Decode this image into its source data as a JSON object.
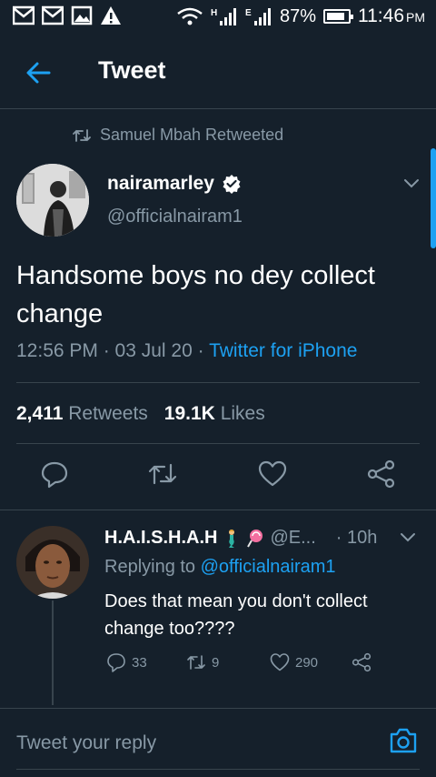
{
  "status_bar": {
    "battery": "87%",
    "battery_level": 0.87,
    "time": "11:46",
    "ampm": "PM",
    "icons": [
      "gmail-icon",
      "gmail-icon",
      "image-icon",
      "alert-icon",
      "wifi-icon",
      "signal-h-icon",
      "signal-e-icon"
    ]
  },
  "header": {
    "title": "Tweet",
    "back_icon": "arrow-left-icon"
  },
  "tweet": {
    "retweeted_by": "Samuel Mbah Retweeted",
    "author_name": "nairamarley",
    "author_handle": "@officialnairam1",
    "text": "Handsome boys no dey collect change",
    "meta_time": "12:56 PM · 03 Jul 20 · ",
    "meta_source": "Twitter for iPhone",
    "retweets_count": "2,411",
    "retweets_label": "Retweets",
    "likes_count": "19.1K",
    "likes_label": "Likes"
  },
  "reply": {
    "name": "H.A.I.S.H.A.H",
    "handle": "@E...",
    "time": "· 10h",
    "replying_prefix": "Replying to ",
    "replying_to": "@officialnairam1",
    "text": "Does that mean you don't collect change too????",
    "reply_count": "33",
    "retweet_count": "9",
    "like_count": "290"
  },
  "composer": {
    "placeholder": "Tweet your reply"
  },
  "colors": {
    "background": "#15202b",
    "accent": "#1da1f2",
    "secondary_text": "#8899a6",
    "divider": "#38444d"
  }
}
